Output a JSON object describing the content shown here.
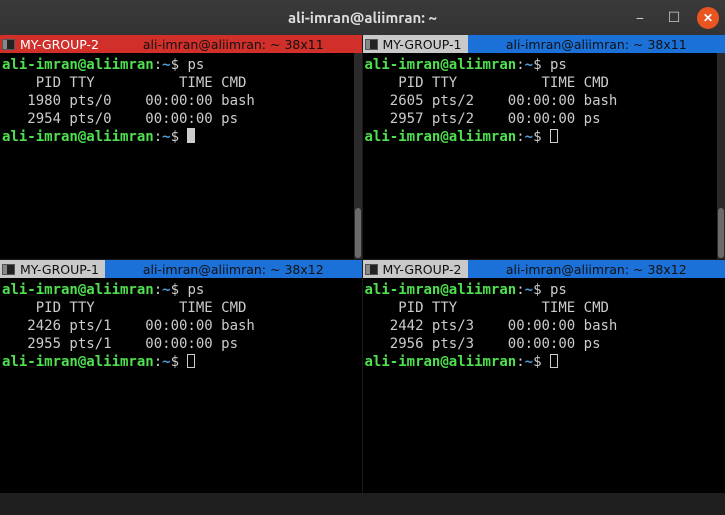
{
  "window": {
    "title": "ali-imran@aliimran: ~",
    "controls": {
      "min": "−",
      "max": "☐",
      "close": "✕"
    }
  },
  "prompt": {
    "user_host": "ali-imran@aliimran",
    "path": "~",
    "dollar": "$"
  },
  "panes": [
    {
      "group": "MY-GROUP-2",
      "group_color": "red",
      "title": "ali-imran@aliimran: ~ 38x11",
      "active": true,
      "command": "ps",
      "header": "    PID TTY          TIME CMD",
      "rows": [
        "   1980 pts/0    00:00:00 bash",
        "   2954 pts/0    00:00:00 ps"
      ]
    },
    {
      "group": "MY-GROUP-1",
      "group_color": "grey",
      "title": "ali-imran@aliimran: ~ 38x11",
      "active": false,
      "command": "ps",
      "header": "    PID TTY          TIME CMD",
      "rows": [
        "   2605 pts/2    00:00:00 bash",
        "   2957 pts/2    00:00:00 ps"
      ]
    },
    {
      "group": "MY-GROUP-1",
      "group_color": "grey",
      "title": "ali-imran@aliimran: ~ 38x12",
      "active": false,
      "command": "ps",
      "header": "    PID TTY          TIME CMD",
      "rows": [
        "   2426 pts/1    00:00:00 bash",
        "   2955 pts/1    00:00:00 ps"
      ]
    },
    {
      "group": "MY-GROUP-2",
      "group_color": "grey",
      "title": "ali-imran@aliimran: ~ 38x12",
      "active": false,
      "command": "ps",
      "header": "    PID TTY          TIME CMD",
      "rows": [
        "   2442 pts/3    00:00:00 bash",
        "   2956 pts/3    00:00:00 ps"
      ]
    }
  ]
}
